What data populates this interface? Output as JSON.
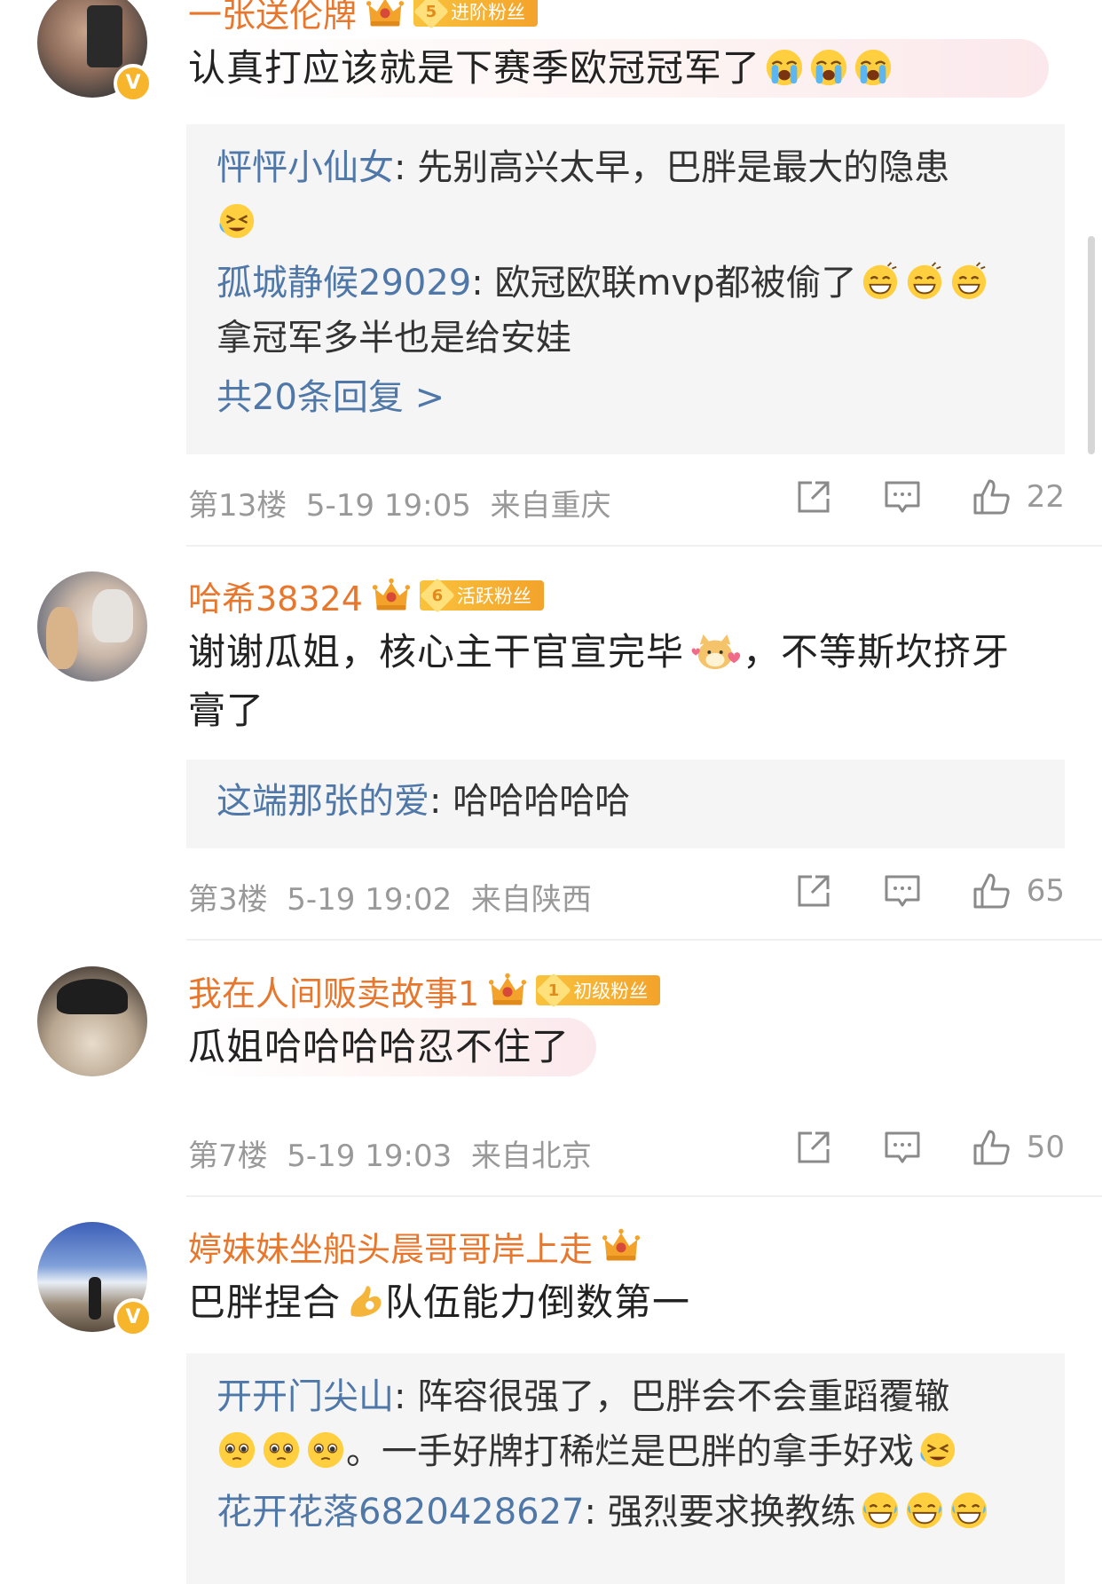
{
  "comments": [
    {
      "username": "一张送伦牌",
      "fan_level": "5",
      "fan_badge": "进阶粉丝",
      "verified": "V",
      "text": "认真打应该就是下赛季欧冠冠军了",
      "replies": [
        {
          "name": "怦怦小仙女",
          "text": "先别高兴太早，巴胖是最大的隐患"
        },
        {
          "name": "孤城静候29029",
          "text": "欧冠欧联mvp都被偷了",
          "text2": "拿冠军多半也是给安娃"
        }
      ],
      "reply_total": "共20条回复 >",
      "floor": "第13楼",
      "date": "5-19 19:05",
      "location": "来自重庆",
      "likes": "22"
    },
    {
      "username": "哈希38324",
      "fan_level": "6",
      "fan_badge": "活跃粉丝",
      "text_line1": "谢谢瓜姐，核心主干官宣完毕",
      "text_line1b": "，不等斯坎挤牙",
      "text_line2": "膏了",
      "replies": [
        {
          "name": "这端那张的爱",
          "text": "哈哈哈哈哈"
        }
      ],
      "floor": "第3楼",
      "date": "5-19 19:02",
      "location": "来自陕西",
      "likes": "65"
    },
    {
      "username": "我在人间贩卖故事1",
      "fan_level": "1",
      "fan_badge": "初级粉丝",
      "text": "瓜姐哈哈哈哈忍不住了",
      "floor": "第7楼",
      "date": "5-19 19:03",
      "location": "来自北京",
      "likes": "50"
    },
    {
      "username": "婷妹妹坐船头晨哥哥岸上走",
      "verified": "V",
      "text_a": "巴胖捏合",
      "text_b": "队伍能力倒数第一",
      "replies": [
        {
          "name": "开开门尖山",
          "text": "阵容很强了，巴胖会不会重蹈覆辙",
          "text2": "。一手好牌打稀烂是巴胖的拿手好戏"
        },
        {
          "name": "花开花落6820428627",
          "text": "强烈要求换教练"
        }
      ]
    }
  ],
  "colors": {
    "username": "#e8772e",
    "reply_name": "#4f78a8",
    "meta": "#999999",
    "badge": "#f3a32b"
  },
  "icons": [
    "share-icon",
    "comment-icon",
    "like-icon",
    "crown-icon",
    "crying-emoji",
    "grin-emoji",
    "doge-emoji",
    "ok-hand-emoji",
    "pleading-emoji",
    "laugh-tears-emoji"
  ]
}
